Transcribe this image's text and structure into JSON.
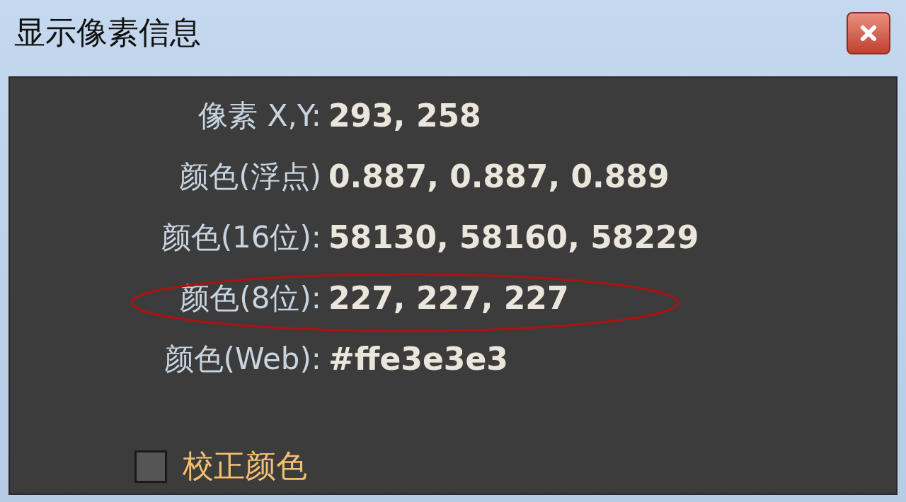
{
  "window": {
    "title": "显示像素信息"
  },
  "rows": [
    {
      "label": "像素 X,Y:",
      "value": "293, 258"
    },
    {
      "label": "颜色(浮点)",
      "value": "0.887, 0.887, 0.889"
    },
    {
      "label": "颜色(16位):",
      "value": "58130, 58160, 58229"
    },
    {
      "label": "颜色(8位):",
      "value": "227, 227, 227"
    },
    {
      "label": "颜色(Web):",
      "value": "#ffe3e3e3"
    }
  ],
  "checkbox": {
    "label": "校正颜色",
    "checked": false
  }
}
